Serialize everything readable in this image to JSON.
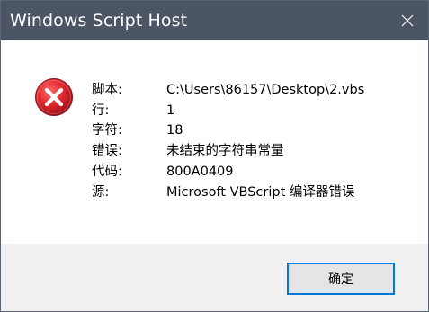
{
  "window": {
    "title": "Windows Script Host"
  },
  "icons": {
    "error": "error-icon",
    "close": "close-icon"
  },
  "colors": {
    "titlebar": "#4b5563",
    "footer": "#f0f0f0",
    "error_red": "#e81123",
    "focus_border": "#0078d7"
  },
  "message": {
    "rows": [
      {
        "label": "脚本:",
        "value": "C:\\Users\\86157\\Desktop\\2.vbs"
      },
      {
        "label": "行:",
        "value": "1"
      },
      {
        "label": "字符:",
        "value": "18"
      },
      {
        "label": "错误:",
        "value": "未结束的字符串常量"
      },
      {
        "label": "代码:",
        "value": "800A0409"
      },
      {
        "label": "源:",
        "value": "Microsoft VBScript 编译器错误"
      }
    ]
  },
  "buttons": {
    "ok_label": "确定"
  }
}
